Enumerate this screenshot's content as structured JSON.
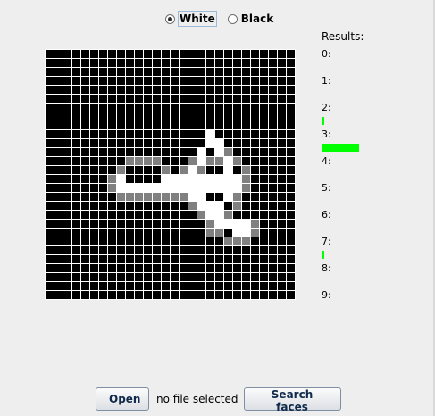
{
  "color_mode": {
    "options": [
      {
        "label": "White",
        "selected": true
      },
      {
        "label": "Black",
        "selected": false
      }
    ]
  },
  "grid": {
    "size": 28,
    "background_color": "#000000",
    "gridline_color": "#ffffff",
    "levels": {
      "1": "#ffffff",
      "2": "#808080"
    },
    "pixels": [
      "............................",
      "............................",
      "............................",
      "............................",
      "............................",
      "............................",
      "............................",
      "............................",
      "............................",
      "............................",
      "............................",
      "............................",
      "............................",
      "............................",
      "............................",
      "............................",
      "............................",
      "............................",
      "............................",
      "............................",
      "............................",
      "............................",
      "............................",
      "............................",
      "............................",
      "............................",
      "............................",
      "............................"
    ],
    "strokes": {
      "white": [
        [
          8,
          14
        ],
        [
          8,
          15
        ],
        [
          9,
          15
        ],
        [
          10,
          15
        ],
        [
          11,
          15
        ],
        [
          12,
          15
        ],
        [
          13,
          14
        ],
        [
          14,
          14
        ],
        [
          15,
          14
        ],
        [
          16,
          14
        ],
        [
          16,
          13
        ],
        [
          17,
          12
        ],
        [
          17,
          11
        ],
        [
          18,
          10
        ],
        [
          18,
          9
        ],
        [
          19,
          10
        ],
        [
          19,
          11
        ],
        [
          20,
          12
        ],
        [
          20,
          13
        ],
        [
          21,
          14
        ],
        [
          21,
          15
        ],
        [
          20,
          16
        ],
        [
          19,
          17
        ],
        [
          18,
          17
        ],
        [
          17,
          16
        ],
        [
          17,
          15
        ],
        [
          18,
          14
        ],
        [
          19,
          14
        ],
        [
          20,
          14
        ],
        [
          20,
          15
        ],
        [
          19,
          15
        ],
        [
          18,
          15
        ],
        [
          17,
          14
        ],
        [
          16,
          15
        ],
        [
          15,
          15
        ],
        [
          14,
          15
        ],
        [
          13,
          15
        ],
        [
          16,
          16
        ],
        [
          17,
          17
        ],
        [
          18,
          18
        ],
        [
          19,
          18
        ],
        [
          19,
          19
        ],
        [
          20,
          19
        ],
        [
          21,
          19
        ],
        [
          21,
          20
        ],
        [
          22,
          20
        ],
        [
          22,
          19
        ]
      ],
      "gray": [
        [
          8,
          13
        ],
        [
          9,
          12
        ],
        [
          10,
          12
        ],
        [
          11,
          12
        ],
        [
          12,
          12
        ],
        [
          13,
          13
        ],
        [
          15,
          13
        ],
        [
          16,
          12
        ],
        [
          17,
          13
        ],
        [
          18,
          12
        ],
        [
          19,
          12
        ],
        [
          20,
          11
        ],
        [
          21,
          12
        ],
        [
          22,
          13
        ],
        [
          22,
          14
        ],
        [
          22,
          15
        ],
        [
          21,
          16
        ],
        [
          21,
          17
        ],
        [
          20,
          18
        ],
        [
          18,
          19
        ],
        [
          17,
          18
        ],
        [
          16,
          17
        ],
        [
          15,
          16
        ],
        [
          14,
          16
        ],
        [
          9,
          16
        ],
        [
          10,
          16
        ],
        [
          11,
          16
        ],
        [
          12,
          16
        ],
        [
          13,
          16
        ],
        [
          8,
          16
        ],
        [
          7,
          15
        ],
        [
          7,
          14
        ],
        [
          19,
          20
        ],
        [
          20,
          21
        ],
        [
          21,
          21
        ],
        [
          22,
          21
        ],
        [
          23,
          20
        ],
        [
          23,
          19
        ],
        [
          18,
          20
        ]
      ]
    }
  },
  "results": {
    "title": "Results:",
    "items": [
      {
        "label": "0:",
        "score": 0.0
      },
      {
        "label": "1:",
        "score": 0.0
      },
      {
        "label": "2:",
        "score": 0.05
      },
      {
        "label": "3:",
        "score": 1.0
      },
      {
        "label": "4:",
        "score": 0.0
      },
      {
        "label": "5:",
        "score": 0.0
      },
      {
        "label": "6:",
        "score": 0.0
      },
      {
        "label": "7:",
        "score": 0.05
      },
      {
        "label": "8:",
        "score": 0.0
      },
      {
        "label": "9:",
        "score": 0.0
      }
    ],
    "bar_color": "#00ff00"
  },
  "actions": {
    "open_label": "Open",
    "file_status": "no file selected",
    "search_label": "Search faces"
  }
}
